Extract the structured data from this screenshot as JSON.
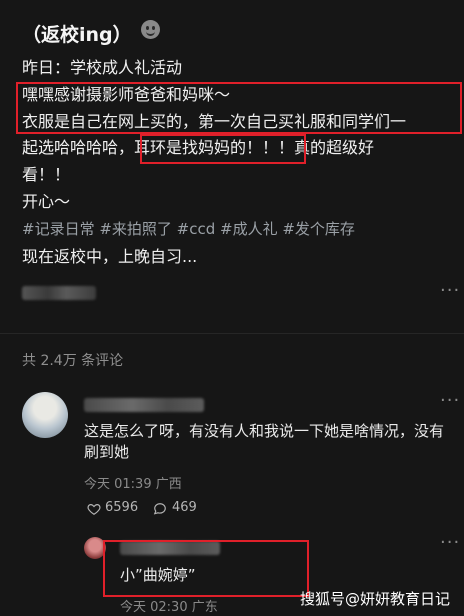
{
  "post": {
    "title": "（返校ing）",
    "lines": [
      "昨日：学校成人礼活动",
      "嘿嘿感谢摄影师爸爸和妈咪～",
      "衣服是自己在网上买的，第一次自己买礼服和同学们一",
      "起选哈哈哈哈，耳环是找妈妈的！！！真的超级好",
      "看！！",
      "开心～"
    ],
    "hashtags": "#记录日常 #来拍照了 #ccd #成人礼 #发个库存",
    "last_line": "现在返校中，上晚自习..."
  },
  "comments_header": "共 2.4万 条评论",
  "comment": {
    "text_line1": "这是怎么了呀，有没有人和我说一下她是啥情况，没有",
    "text_line2": "刷到她",
    "time": "今天 01:39 广西",
    "likes": "6596",
    "replies": "469"
  },
  "reply": {
    "text": "小”曲婉婷”",
    "time": "今天 02:30 广东"
  },
  "watermark": "搜狐号@妍妍教育日记",
  "highlight_color": "#e0202a"
}
